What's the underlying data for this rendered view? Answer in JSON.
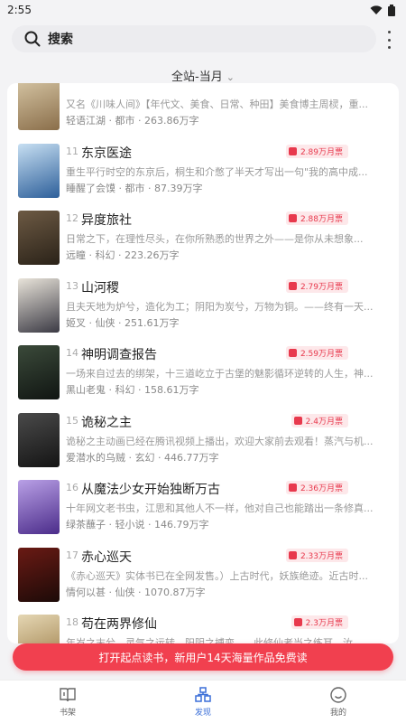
{
  "status": {
    "time": "2:55"
  },
  "search": {
    "placeholder": "搜索"
  },
  "filter": {
    "label": "全站-当月"
  },
  "books": [
    {
      "rank": "",
      "title": "",
      "tickets": "",
      "desc": "又名《川味人间》【年代文、美食、日常、种田】美食博主周棂，重...",
      "meta": "轻语江湖 · 都市 · 263.86万字",
      "cover": [
        "#d9c9a8",
        "#8a6e4a"
      ]
    },
    {
      "rank": "11",
      "title": "东京医途",
      "tickets": "2.89万月票",
      "desc": "重生平行时空的东京后，桐生和介憋了半天才写出一句\"我的高中成...",
      "meta": "睡醒了会馍 · 都市 · 87.39万字",
      "cover": [
        "#c7dff2",
        "#2d5f9a"
      ]
    },
    {
      "rank": "12",
      "title": "异度旅社",
      "tickets": "2.88万月票",
      "desc": "日常之下，在理性尽头，在你所熟悉的世界之外——是你从未想象...",
      "meta": "远瞳 · 科幻 · 223.26万字",
      "cover": [
        "#6d5a44",
        "#2a2218"
      ]
    },
    {
      "rank": "13",
      "title": "山河稷",
      "tickets": "2.79万月票",
      "desc": "且夫天地为炉兮，造化为工；阴阳为炭兮，万物为铜。——终有一天...",
      "meta": "姬叉 · 仙侠 · 251.61万字",
      "cover": [
        "#e9e4da",
        "#3b3a44"
      ]
    },
    {
      "rank": "14",
      "title": "神明调查报告",
      "tickets": "2.59万月票",
      "desc": "一场来自过去的绑架，十三道屹立于古堡的魅影循环逆转的人生，神...",
      "meta": "黑山老鬼 · 科幻 · 158.61万字",
      "cover": [
        "#3b4a3a",
        "#101512"
      ]
    },
    {
      "rank": "15",
      "title": "诡秘之主",
      "tickets": "2.4万月票",
      "desc": "诡秘之主动画已经在腾讯视频上播出，欢迎大家前去观看！蒸汽与机...",
      "meta": "爱潜水的乌贼 · 玄幻 · 446.77万字",
      "cover": [
        "#4a4a4a",
        "#141414"
      ]
    },
    {
      "rank": "16",
      "title": "从魔法少女开始独断万古",
      "tickets": "2.36万月票",
      "desc": "十年网文老书虫，江思和其他人不一样，他对自己也能踏出一条修真...",
      "meta": "绿茶蘸子 · 轻小说 · 146.79万字",
      "cover": [
        "#b9a0e6",
        "#4b2c8a"
      ]
    },
    {
      "rank": "17",
      "title": "赤心巡天",
      "tickets": "2.33万月票",
      "desc": "《赤心巡天》实体书已在全网发售。）上古时代，妖族绝迹。近古时...",
      "meta": "情何以甚 · 仙侠 · 1070.87万字",
      "cover": [
        "#6a1a14",
        "#1c0a08"
      ]
    },
    {
      "rank": "18",
      "title": "苟在两界修仙",
      "tickets": "2.3万月票",
      "desc": "年岁之末兮，灵气之运转，阳阴之搏变......此修仙者当之练耳，汝...",
      "meta": "",
      "cover": [
        "#e5d7b4",
        "#9a7a44"
      ]
    }
  ],
  "promo": {
    "label": "打开起点读书，新用户14天海量作品免费读"
  },
  "tabs": [
    {
      "label": "书架",
      "icon": "book-icon",
      "active": false
    },
    {
      "label": "发现",
      "icon": "discover-icon",
      "active": true
    },
    {
      "label": "我的",
      "icon": "smile-icon",
      "active": false
    }
  ],
  "colors": {
    "accent": "#3b6fd8",
    "promo": "#f1404f",
    "ticket": "#e8394d"
  }
}
